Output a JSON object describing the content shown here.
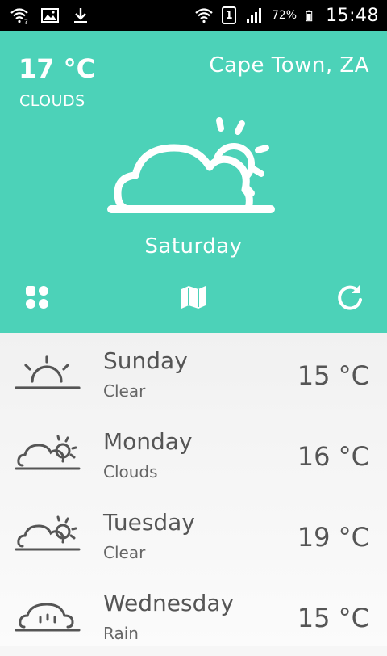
{
  "statusbar": {
    "battery_percent": "72%",
    "clock": "15:48",
    "sim_slot": "1",
    "left_icons": [
      "wifi-question-icon",
      "image-icon",
      "download-icon"
    ],
    "right_icons": [
      "wifi-icon",
      "sim-icon",
      "signal-icon",
      "battery-icon"
    ]
  },
  "current": {
    "temperature": "17 °C",
    "condition": "CLOUDS",
    "location": "Cape Town, ZA",
    "day": "Saturday",
    "icon": "cloud-sun-icon"
  },
  "actions": {
    "left": "grid-icon",
    "center": "map-icon",
    "right": "refresh-icon"
  },
  "forecast": [
    {
      "day": "Sunday",
      "condition": "Clear",
      "temperature": "15 °C",
      "icon": "sunset-icon"
    },
    {
      "day": "Monday",
      "condition": "Clouds",
      "temperature": "16 °C",
      "icon": "cloud-sun-icon"
    },
    {
      "day": "Tuesday",
      "condition": "Clear",
      "temperature": "19 °C",
      "icon": "cloud-sun-icon"
    },
    {
      "day": "Wednesday",
      "condition": "Rain",
      "temperature": "15 °C",
      "icon": "cloud-rain-icon"
    }
  ],
  "colors": {
    "hero": "#4cd2b8",
    "statusbar": "#000000",
    "list_background": "#f6f6f6",
    "list_text": "#555555"
  }
}
